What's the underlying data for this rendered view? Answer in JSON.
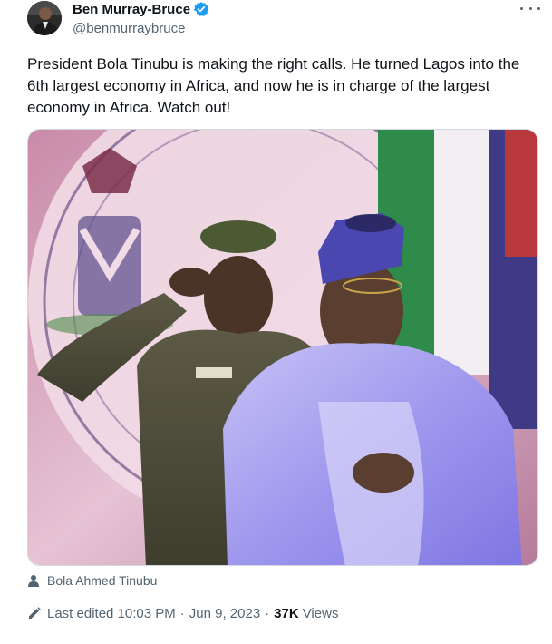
{
  "author": {
    "display_name": "Ben Murray-Bruce",
    "handle": "@benmurraybruce",
    "verified": true,
    "verified_color": "#1d9bf0"
  },
  "tweet": {
    "text": "President Bola Tinubu is making the right calls. He turned Lagos into the 6th largest economy in Africa, and now he is in charge of the largest economy in Africa. Watch out!",
    "tagged_person": "Bola Ahmed Tinubu"
  },
  "meta": {
    "edited_label": "Last edited 10:03 PM",
    "separator": "·",
    "date": "Jun 9, 2023",
    "views_count": "37K",
    "views_label": "Views"
  },
  "icons": {
    "more": "more-horizontal-icon",
    "verified": "verified-badge-icon",
    "tag": "person-icon",
    "edit": "pencil-icon"
  },
  "colors": {
    "text_primary": "#0f1419",
    "text_secondary": "#536471",
    "border": "#cfd9de"
  }
}
